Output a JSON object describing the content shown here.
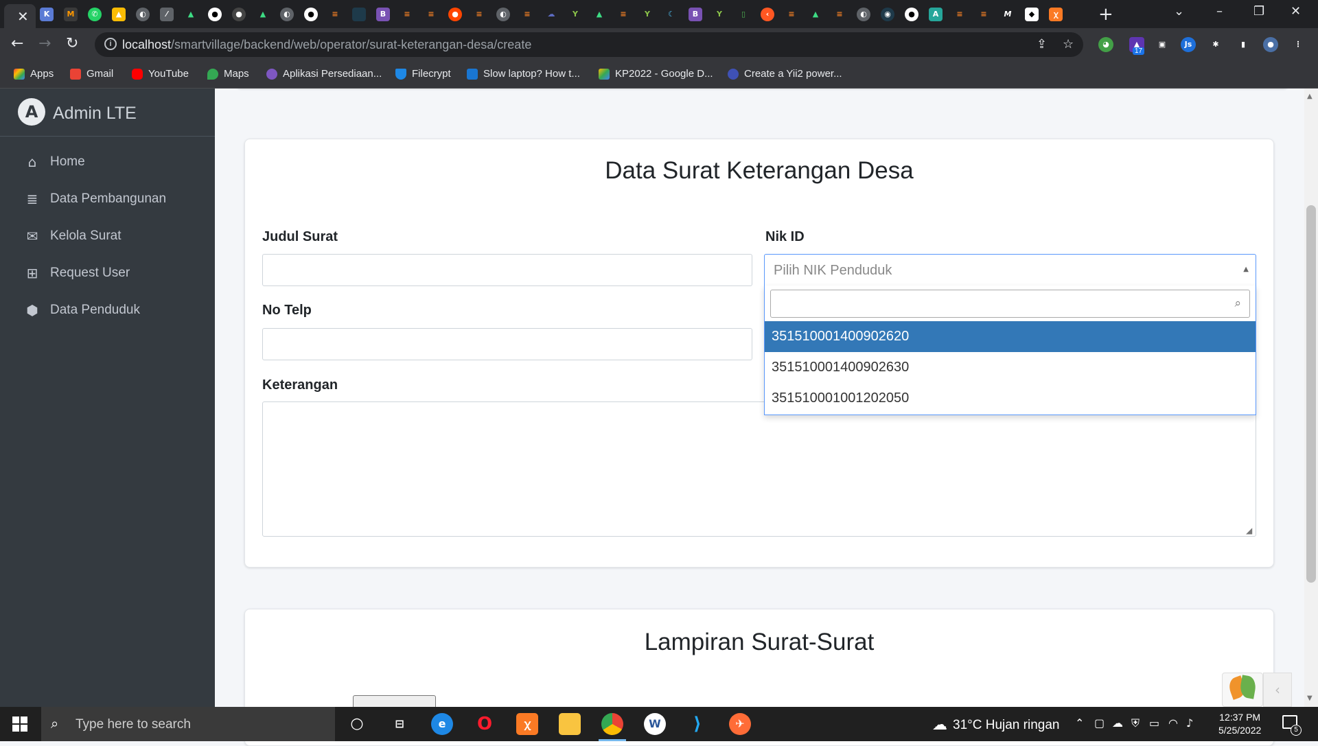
{
  "browser": {
    "url_host": "localhost",
    "url_path": "/smartvillage/backend/web/operator/surat-keterangan-desa/create",
    "extension_badge": "17",
    "bookmarks": [
      {
        "label": "Apps",
        "color": "#ea4335"
      },
      {
        "label": "Gmail",
        "color": "#ea4335"
      },
      {
        "label": "YouTube",
        "color": "#ff0000"
      },
      {
        "label": "Maps",
        "color": "#34a853"
      },
      {
        "label": "Aplikasi Persediaan...",
        "color": "#7e57c2"
      },
      {
        "label": "Filecrypt",
        "color": "#1e88e5"
      },
      {
        "label": "Slow laptop? How t...",
        "color": "#1976d2"
      },
      {
        "label": "KP2022 - Google D...",
        "color": "#fbbc04"
      },
      {
        "label": "Create a Yii2 power...",
        "color": "#3f51b5"
      }
    ]
  },
  "sidebar": {
    "brand": "Admin LTE",
    "items": [
      {
        "label": "Home",
        "icon": "home-icon"
      },
      {
        "label": "Data Pembangunan",
        "icon": "database-icon"
      },
      {
        "label": "Kelola Surat",
        "icon": "envelope-icon"
      },
      {
        "label": "Request User",
        "icon": "gift-icon"
      },
      {
        "label": "Data Penduduk",
        "icon": "cubes-icon"
      }
    ]
  },
  "form": {
    "title": "Data Surat Keterangan Desa",
    "judul_label": "Judul Surat",
    "judul_value": "",
    "nik_label": "Nik ID",
    "nik_placeholder": "Pilih NIK Penduduk",
    "telp_label": "No Telp",
    "telp_value": "",
    "keterangan_label": "Keterangan",
    "keterangan_value": "",
    "nik_options": [
      "351510001400902620",
      "351510001400902630",
      "351510001001202050"
    ],
    "nik_selected_index": 0
  },
  "attachments": {
    "title": "Lampiran Surat-Surat"
  },
  "taskbar": {
    "search_placeholder": "Type here to search",
    "weather": "31°C  Hujan ringan",
    "time": "12:37 PM",
    "date": "5/25/2022",
    "notifications": "5"
  }
}
